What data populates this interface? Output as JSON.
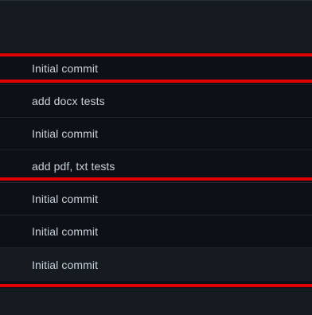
{
  "commits": [
    {
      "message": "Initial commit"
    },
    {
      "message": "add docx tests"
    },
    {
      "message": "Initial commit"
    },
    {
      "message": "add pdf, txt tests"
    },
    {
      "message": "Initial commit"
    },
    {
      "message": "Initial commit"
    },
    {
      "message": "Initial commit"
    }
  ],
  "colors": {
    "background": "#0d1117",
    "band": "#161b22",
    "text": "#c9d1d9",
    "row_divider": "#21262d",
    "highlight_rule": "#e00000"
  }
}
